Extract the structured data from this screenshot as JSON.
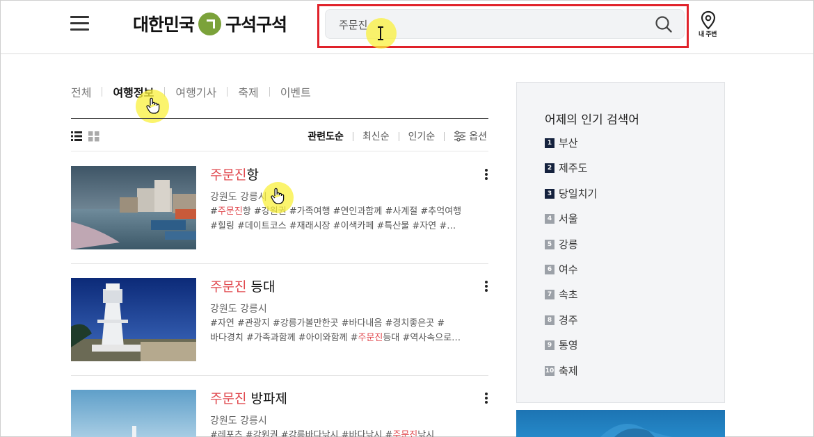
{
  "header": {
    "logo_text_left": "대한민국",
    "logo_text_right": "구석구석",
    "search_value": "주문진",
    "location_label": "내 주변"
  },
  "tabs": [
    {
      "label": "전체"
    },
    {
      "label": "여행정보"
    },
    {
      "label": "여행기사"
    },
    {
      "label": "축제"
    },
    {
      "label": "이벤트"
    }
  ],
  "sort": {
    "relevance": "관련도순",
    "latest": "최신순",
    "popular": "인기순",
    "options": "옵션"
  },
  "results": [
    {
      "title_highlight": "주문진",
      "title_rest": "항",
      "region": "강원도 강릉시",
      "tags_line1_pre": "#",
      "tags_line1_hl": "주문진",
      "tags_line1_post": "항 #강원권 #가족여행 #연인과함께 #사계절 #추억여행",
      "tags_line2": "#힐링 #데이트코스 #재래시장 #이색카페 #특산물 #자연 #…"
    },
    {
      "title_highlight": "주문진",
      "title_rest": " 등대",
      "region": "강원도 강릉시",
      "tags_line1": "#자연 #관광지 #강릉가볼만한곳 #바다내음 #경치좋은곳 #",
      "tags_line2_pre": "바다경치 #가족과함께 #아이와함께 #",
      "tags_line2_hl": "주문진",
      "tags_line2_post": "등대 #역사속으로…"
    },
    {
      "title_highlight": "주문진",
      "title_rest": " 방파제",
      "region": "강원도 강릉시",
      "tags_line1_pre": "#레포츠 #강원권 #강릉바다낚시 #바다낚시 #",
      "tags_line1_hl": "주문진",
      "tags_line1_post": "낚시"
    }
  ],
  "popular": {
    "title": "어제의 인기 검색어",
    "items": [
      {
        "rank": "1",
        "label": "부산"
      },
      {
        "rank": "2",
        "label": "제주도"
      },
      {
        "rank": "3",
        "label": "당일치기"
      },
      {
        "rank": "4",
        "label": "서울"
      },
      {
        "rank": "5",
        "label": "강릉"
      },
      {
        "rank": "6",
        "label": "여수"
      },
      {
        "rank": "7",
        "label": "속초"
      },
      {
        "rank": "8",
        "label": "경주"
      },
      {
        "rank": "9",
        "label": "통영"
      },
      {
        "rank": "10",
        "label": "축제"
      }
    ]
  },
  "colors": {
    "highlight": "#e0484e",
    "search_outline": "#e0222a",
    "logo_green": "#7ba23a",
    "rank_top": "#14213d",
    "rank_rest": "#9ca1a8"
  }
}
